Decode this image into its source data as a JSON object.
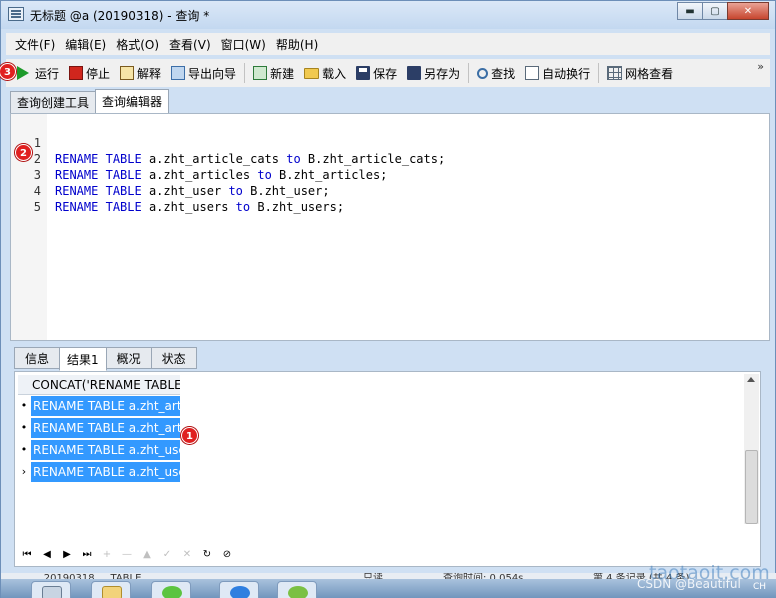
{
  "window": {
    "title": "无标题 @a (20190318) - 查询 *",
    "minimize_symbol": "▬",
    "maximize_symbol": "▢",
    "close_symbol": "✕"
  },
  "menubar": {
    "items": [
      "文件(F)",
      "编辑(E)",
      "格式(O)",
      "查看(V)",
      "窗口(W)",
      "帮助(H)"
    ]
  },
  "toolbar": {
    "run": "运行",
    "stop": "停止",
    "explain": "解释",
    "export_wizard": "导出向导",
    "new": "新建",
    "load": "载入",
    "save": "保存",
    "save_as": "另存为",
    "find": "查找",
    "word_wrap": "自动换行",
    "grid_view": "网格查看",
    "overflow": "»"
  },
  "top_tabs": [
    "查询创建工具",
    "查询编辑器"
  ],
  "editor": {
    "lines": [
      {
        "num": "1",
        "kw1": "RENAME",
        "kw2": "TABLE",
        "from": "a.zht_article_cats",
        "to_kw": "to",
        "to": "B.zht_article_cats;"
      },
      {
        "num": "2",
        "kw1": "RENAME",
        "kw2": "TABLE",
        "from": "a.zht_articles",
        "to_kw": "to",
        "to": "B.zht_articles;"
      },
      {
        "num": "3",
        "kw1": "RENAME",
        "kw2": "TABLE",
        "from": "a.zht_user",
        "to_kw": "to",
        "to": "B.zht_user;"
      },
      {
        "num": "4",
        "kw1": "RENAME",
        "kw2": "TABLE",
        "from": "a.zht_users",
        "to_kw": "to",
        "to": "B.zht_users;"
      },
      {
        "num": "5",
        "kw1": "",
        "kw2": "",
        "from": "",
        "to_kw": "",
        "to": ""
      }
    ]
  },
  "bottom_tabs": [
    "信息",
    "结果1",
    "概况",
    "状态"
  ],
  "result": {
    "column_header": "CONCAT('RENAME TABLE",
    "rows": [
      {
        "marker": "•",
        "value": "RENAME TABLE a.zht_arti"
      },
      {
        "marker": "•",
        "value": "RENAME TABLE a.zht_arti"
      },
      {
        "marker": "•",
        "value": "RENAME TABLE a.zht_use"
      },
      {
        "marker": "›",
        "value": "RENAME TABLE a.zht_use"
      }
    ]
  },
  "navigator": [
    "⏮",
    "◀",
    "▶",
    "⏭",
    "+",
    "—",
    "▲",
    "✓",
    "✕",
    "↻",
    "⊘"
  ],
  "badges": [
    "1",
    "2",
    "3"
  ],
  "status": {
    "left": "... 20190318 ... TABLE ...",
    "mode": "只读",
    "query_time": "查询时间: 0.054s",
    "record": "第 4 条记录 (共 4 条)"
  },
  "watermark": {
    "csdn": "CSDN @Beautiful",
    "site": "taotaoit.com"
  },
  "taskbar": {
    "ime": "CH"
  },
  "colors": {
    "selection": "#3399ff",
    "keyword": "#0000cc",
    "badge": "#e02020",
    "run_green": "#1d9a2a",
    "stop_red": "#d0261d"
  }
}
